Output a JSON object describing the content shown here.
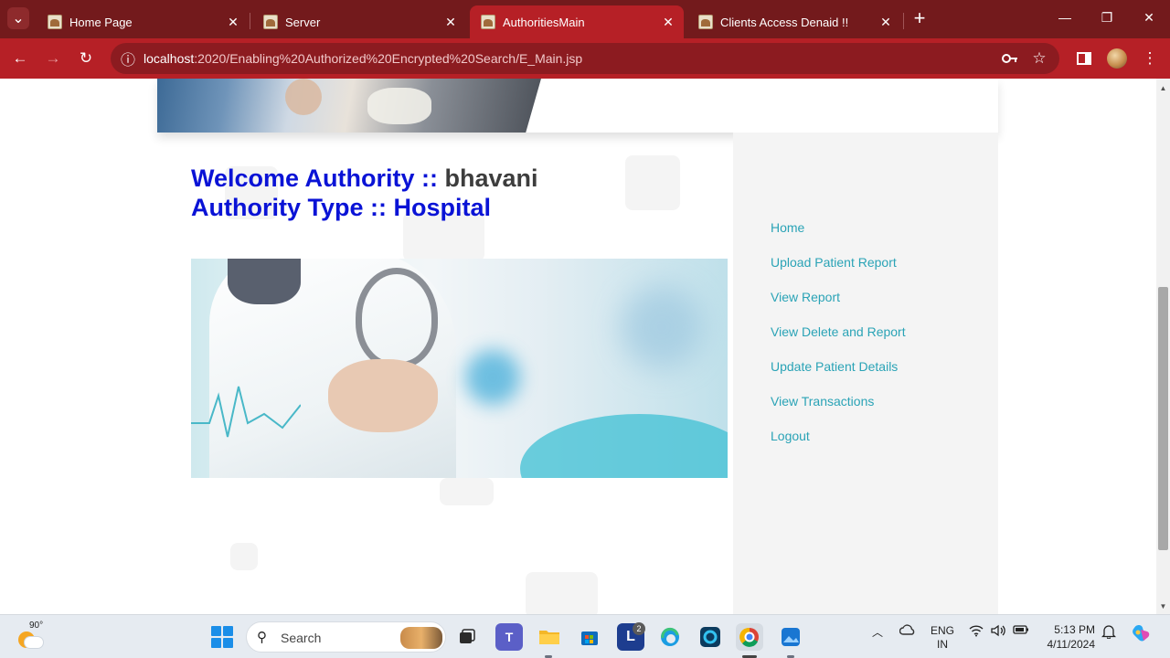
{
  "browser": {
    "tabs": [
      {
        "title": "Home Page",
        "active": false
      },
      {
        "title": "Server",
        "active": false
      },
      {
        "title": "AuthoritiesMain",
        "active": true
      },
      {
        "title": "Clients Access Denaid !!",
        "active": false
      }
    ],
    "url_host": "localhost",
    "url_rest": ":2020/Enabling%20Authorized%20Encrypted%20Search/E_Main.jsp"
  },
  "page": {
    "welcome_label": "Welcome Authority :: ",
    "welcome_name": "bhavani",
    "type_label": "Authority Type :: ",
    "type_value": "Hospital",
    "nav": [
      "Home",
      "Upload Patient Report",
      "View Report",
      "View Delete and Report",
      "Update Patient Details",
      "View Transactions",
      "Logout"
    ],
    "colors": {
      "heading": "#0a13d6",
      "nav_link": "#2aa3b6",
      "browser_frame": "#b62026"
    }
  },
  "taskbar": {
    "temperature": "90°",
    "search_label": "Search",
    "app_badge": "2",
    "lang_line1": "ENG",
    "lang_line2": "IN",
    "time": "5:13 PM",
    "date": "4/11/2024"
  }
}
